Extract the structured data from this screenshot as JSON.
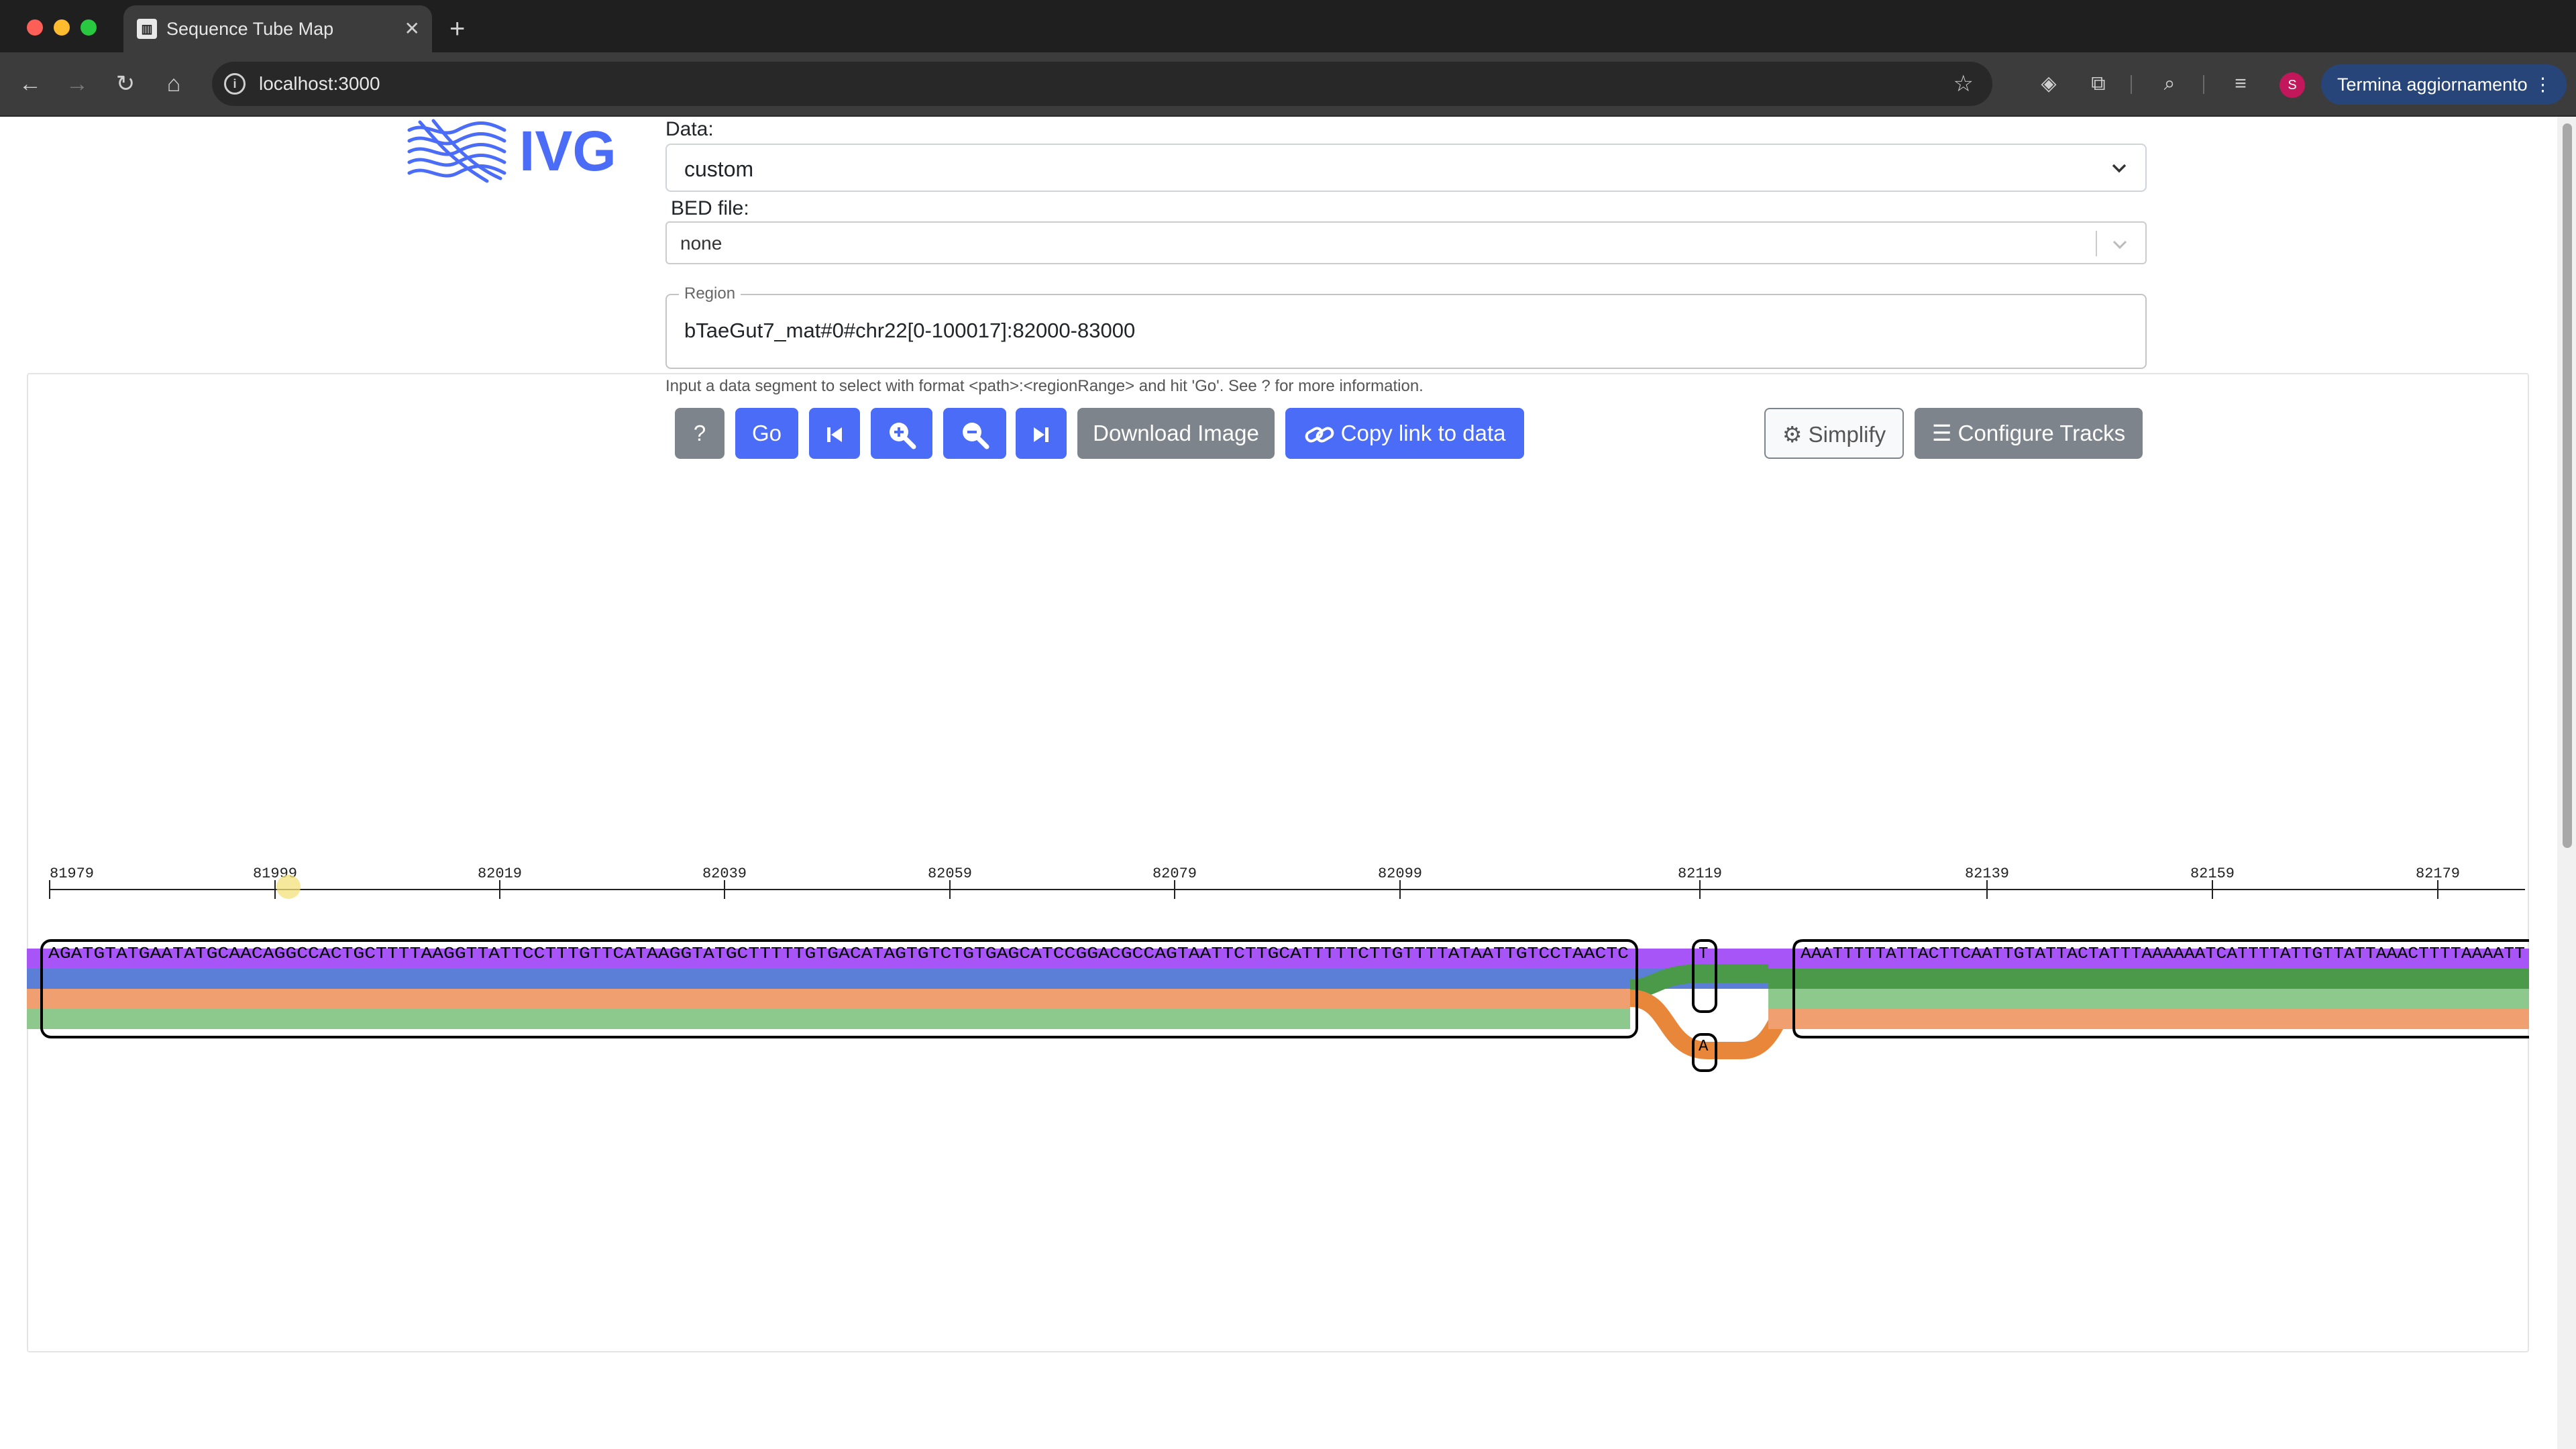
{
  "browser": {
    "tab_title": "Sequence Tube Map",
    "url": "localhost:3000",
    "update_button": "Termina aggiornamento",
    "avatar_letter": "S"
  },
  "app": {
    "logo_text": "IVG",
    "data_label": "Data:",
    "data_value": "custom",
    "bed_label": "BED file:",
    "bed_value": "none",
    "region_label": "Region",
    "region_value": "bTaeGut7_mat#0#chr22[0-100017]:82000-83000",
    "hint": "Input a data segment to select with format <path>:<regionRange> and hit 'Go'. See ? for more information.",
    "buttons": {
      "help": "?",
      "go": "Go",
      "download": "Download Image",
      "copy_link": "Copy link to data",
      "simplify": "Simplify",
      "configure": "Configure Tracks"
    },
    "icons": [
      "skip-back-icon",
      "zoom-in-icon",
      "zoom-out-icon",
      "skip-forward-icon",
      "link-icon",
      "gear-icon",
      "list-icon"
    ]
  },
  "tubemap": {
    "ruler_ticks": [
      "81979",
      "81999",
      "82019",
      "82039",
      "82059",
      "82079",
      "82099",
      "82119",
      "82139",
      "82159",
      "82179"
    ],
    "node1_sequence": "AGATGTATGAATATGCAACAGGCCACTGCTTTTAAGGTTATTCCTTTGTTCATAAGGTATGCTTTTTGTGACATAGTGTCTGTGAGCATCCGGACGCCAGTAATTCTTGCATTTTTCTTGTTTTATAATTGTCCTAACTC",
    "node2_sequence": "T",
    "node3_sequence": "A",
    "node4_sequence": "AAATTTTTATTACTTCAATTGTATTACTATTTAAAAAATCATTTTATTGTTATTAAACTTTTAAAATT",
    "track_colors": {
      "purple": "#a855f7",
      "blue": "#5b7fd6",
      "light_blue": "#8eb0e8",
      "orange": "#f0a070",
      "green": "#8dc98d",
      "dark_orange": "#e8863a",
      "dark_green": "#4a9a4a"
    }
  }
}
